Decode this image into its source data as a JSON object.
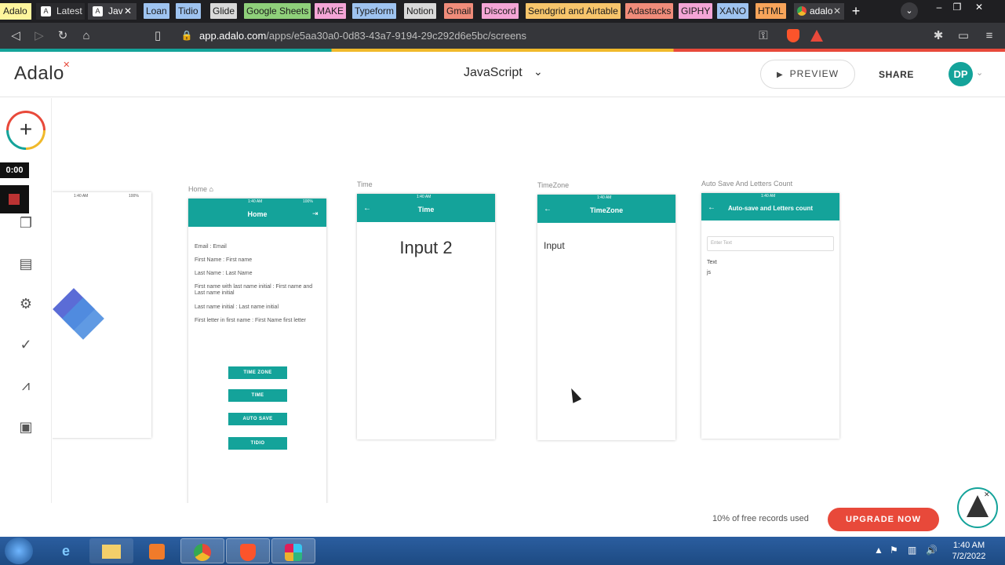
{
  "browser": {
    "tabs": [
      {
        "label": "Adalo",
        "bg": "#fff59d",
        "color": "#1b1b1b"
      },
      {
        "label": "Latest",
        "bg": "#2a2a2d",
        "color": "#e0e0e0"
      },
      {
        "label": "Jav",
        "bg": "#3b3b3f",
        "color": "#ffffff"
      }
    ],
    "bookmarks": [
      {
        "label": "Loan",
        "bg": "#9ec3f0"
      },
      {
        "label": "Tidio",
        "bg": "#9ec3f0"
      },
      {
        "label": "Glide",
        "bg": "#d9d9d9"
      },
      {
        "label": "Google Sheets",
        "bg": "#8fd07a"
      },
      {
        "label": "MAKE",
        "bg": "#f4a5d6"
      },
      {
        "label": "Typeform",
        "bg": "#9ec3f0"
      },
      {
        "label": "Notion",
        "bg": "#d9d9d9"
      },
      {
        "label": "Gmail",
        "bg": "#f08c7a"
      },
      {
        "label": "Discord",
        "bg": "#f4a5d6"
      },
      {
        "label": "Sendgrid and Airtable",
        "bg": "#f7c56b"
      },
      {
        "label": "Adastacks",
        "bg": "#f08c7a"
      },
      {
        "label": "GIPHY",
        "bg": "#f4a5d6"
      },
      {
        "label": "XANO",
        "bg": "#9ec3f0"
      },
      {
        "label": "HTML",
        "bg": "#f7a45a"
      }
    ],
    "last_tab": "adalo",
    "url_host": "app.adalo.com",
    "url_path": "/apps/e5aa30a0-0d83-43a7-9194-29c292d6e5bc/screens"
  },
  "header": {
    "logo": "Adalo",
    "app_name": "JavaScript",
    "preview_label": "PREVIEW",
    "share_label": "SHARE",
    "avatar_initials": "DP"
  },
  "recorder": {
    "timer": "0:00"
  },
  "screens": {
    "home": {
      "label": "Home",
      "title": "Home",
      "lines": [
        "Email : Email",
        "First Name : First name",
        "Last Name : Last Name",
        "First name with last name initial : First name and Last name initial",
        "Last name initial : Last name initial",
        "First letter in first name : First Name first letter"
      ],
      "buttons": [
        "TIME ZONE",
        "TIME",
        "AUTO SAVE",
        "TIDIO"
      ]
    },
    "time": {
      "label": "Time",
      "title": "Time",
      "body": "Input 2"
    },
    "timezone": {
      "label": "TimeZone",
      "title": "TimeZone",
      "body": "Input"
    },
    "autosave": {
      "label": "Auto Save And Letters Count",
      "title": "Auto-save and Letters count",
      "placeholder": "Enter Text",
      "text1": "Text",
      "text2": "js"
    },
    "status_time": "1:40 AM",
    "status_battery": "100%"
  },
  "footer": {
    "records_text": "10% of free records used",
    "upgrade_label": "UPGRADE NOW"
  },
  "taskbar": {
    "time": "1:40 AM",
    "date": "7/2/2022"
  }
}
